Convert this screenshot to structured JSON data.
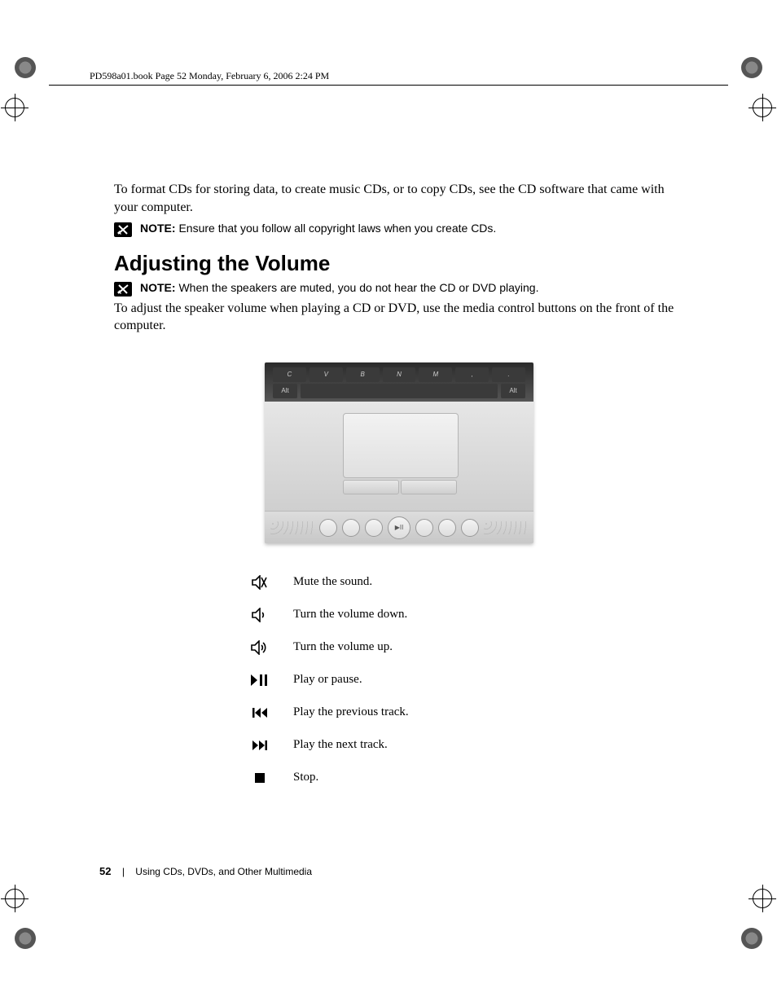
{
  "runhead": "PD598a01.book  Page 52  Monday, February 6, 2006  2:24 PM",
  "intro": "To format CDs for storing data, to create music CDs, or to copy CDs, see the CD software that came with your computer.",
  "note1_label": "NOTE:",
  "note1_text": " Ensure that you follow all copyright laws when you create CDs.",
  "heading": "Adjusting the Volume",
  "note2_label": "NOTE:",
  "note2_text": " When the speakers are muted, you do not hear the CD or DVD playing.",
  "body2": "To adjust the speaker volume when playing a CD or DVD, use the media control buttons on the front of the computer.",
  "legend": {
    "mute": "Mute the sound.",
    "voldown": "Turn the volume down.",
    "volup": "Turn the volume up.",
    "playpause": "Play or pause.",
    "prev": "Play the previous track.",
    "next": "Play the next track.",
    "stop": "Stop."
  },
  "footer": {
    "page": "52",
    "section": "Using CDs, DVDs, and Other Multimedia"
  },
  "keys": [
    "C",
    "V",
    "B",
    "N",
    "M",
    ",",
    "."
  ]
}
